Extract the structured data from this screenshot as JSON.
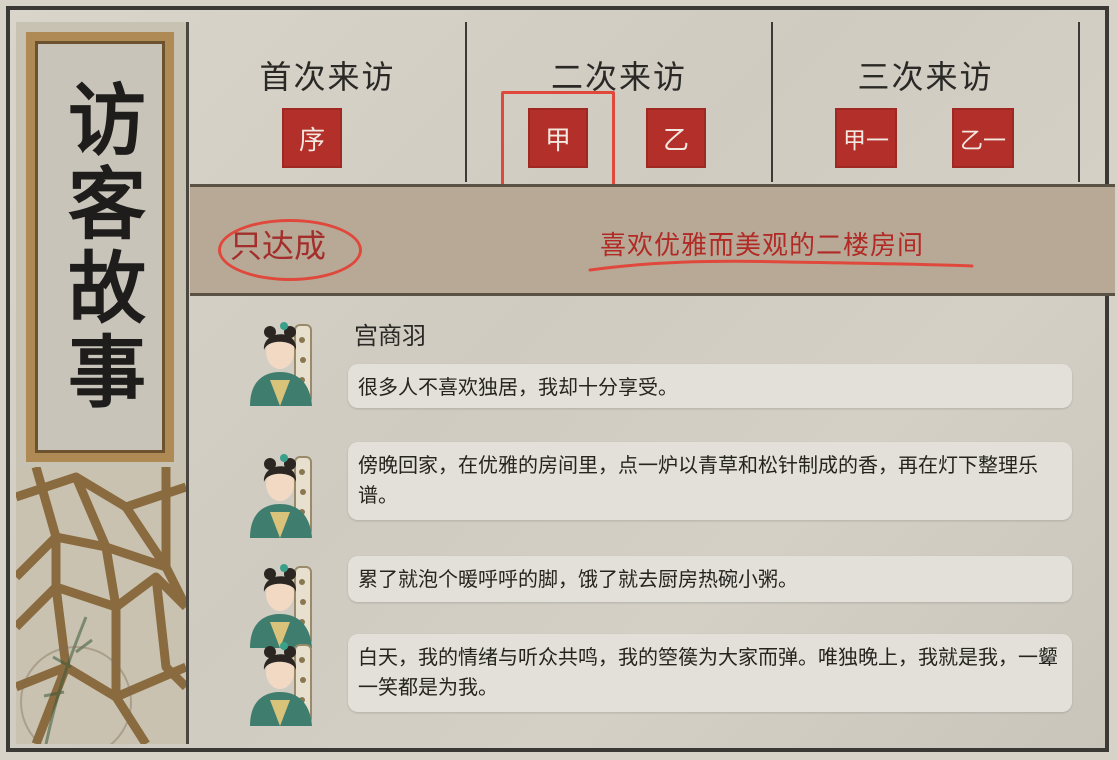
{
  "panel": {
    "title": "访客故事"
  },
  "visits": [
    {
      "title": "首次来访",
      "seals": [
        "序"
      ]
    },
    {
      "title": "二次来访",
      "seals": [
        "甲",
        "乙"
      ]
    },
    {
      "title": "三次来访",
      "seals": [
        "甲一",
        "乙一"
      ]
    }
  ],
  "visitor": {
    "name": "只达成",
    "preference": "喜欢优雅而美观的二楼房间"
  },
  "dialogue": {
    "speaker": "宫商羽",
    "lines": [
      "很多人不喜欢独居，我却十分享受。",
      "傍晚回家，在优雅的房间里，点一炉以青草和松针制成的香，再在灯下整理乐谱。",
      "累了就泡个暖呼呼的脚，饿了就去厨房热碗小粥。",
      "白天，我的情绪与听众共鸣，我的箜篌为大家而弹。唯独晚上，我就是我，一颦一笑都是为我。"
    ]
  },
  "colors": {
    "seal_red": "#b3302a",
    "highlight_red": "#e0483c",
    "band": "#b7a996",
    "frame": "#3a3936"
  }
}
